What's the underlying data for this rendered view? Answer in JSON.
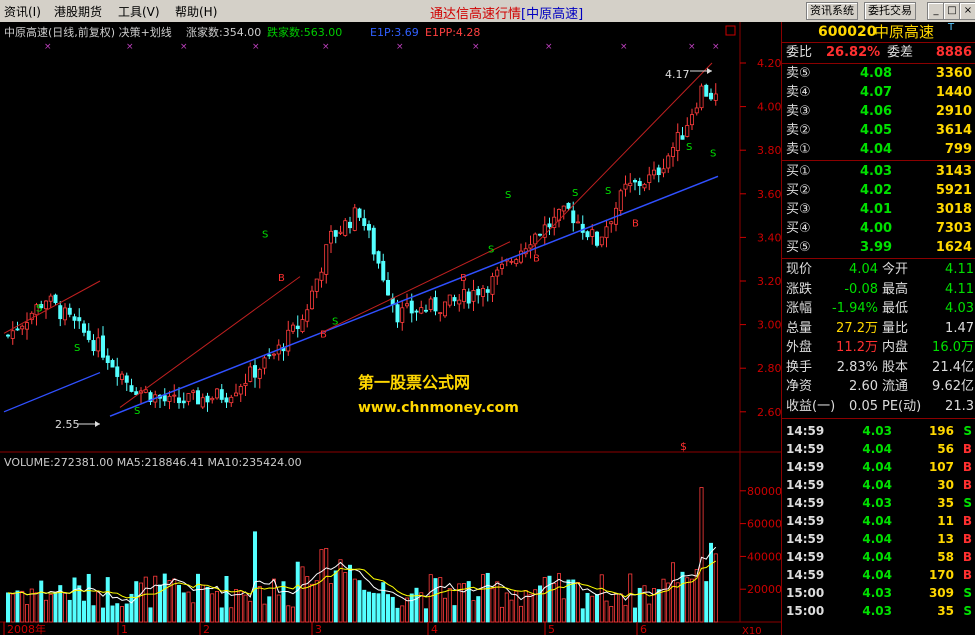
{
  "menu": [
    "资讯(I)",
    "港股期货",
    "工具(V)",
    "帮助(H)"
  ],
  "app_title": "通达信高速行情",
  "app_stock": "[中原高速]",
  "toolbar_buttons": [
    "资讯系统",
    "委托交易"
  ],
  "window_buttons": [
    "_",
    "□",
    "×"
  ],
  "chart": {
    "header": "中原高速(日线,前复权) 决策+划线",
    "up_count": "涨家数:354.00",
    "down_count": "跌家数:563.00",
    "e1p": "E1P:3.69",
    "e1pp": "E1PP:4.28",
    "ylabels": [
      "4.20",
      "4.00",
      "3.80",
      "3.60",
      "3.40",
      "3.20",
      "3.00",
      "2.80",
      "2.60"
    ],
    "low_label": "2.55",
    "high_label": "4.17",
    "watermark_cn": "第一股票公式网",
    "watermark_url": "www.chnmoney.com",
    "volume_header": "VOLUME:272381.00  MA5:218846.41  MA10:235424.00",
    "vol_ylabels": [
      "80000",
      "60000",
      "40000",
      "20000"
    ],
    "vol_unit": "X10",
    "x_labels": [
      "2008年",
      "1",
      "2",
      "3",
      "4",
      "5",
      "6"
    ],
    "signal_b": "B",
    "signal_s": "S",
    "marker": "$",
    "crosses": "×"
  },
  "quote": {
    "code": "600020",
    "name": "中原高速",
    "weibi_label": "委比",
    "weibi_value": "26.82%",
    "weicha_label": "委差",
    "weicha_value": "8886",
    "sells": [
      {
        "label": "卖⑤",
        "price": "4.08",
        "vol": "3360"
      },
      {
        "label": "卖④",
        "price": "4.07",
        "vol": "1440"
      },
      {
        "label": "卖③",
        "price": "4.06",
        "vol": "2910"
      },
      {
        "label": "卖②",
        "price": "4.05",
        "vol": "3614"
      },
      {
        "label": "卖①",
        "price": "4.04",
        "vol": "799"
      }
    ],
    "buys": [
      {
        "label": "买①",
        "price": "4.03",
        "vol": "3143"
      },
      {
        "label": "买②",
        "price": "4.02",
        "vol": "5921"
      },
      {
        "label": "买③",
        "price": "4.01",
        "vol": "3018"
      },
      {
        "label": "买④",
        "price": "4.00",
        "vol": "7303"
      },
      {
        "label": "买⑤",
        "price": "3.99",
        "vol": "1624"
      }
    ],
    "stats": [
      {
        "l1": "现价",
        "v1": "4.04",
        "l2": "今开",
        "v2": "4.11"
      },
      {
        "l1": "涨跌",
        "v1": "-0.08",
        "l2": "最高",
        "v2": "4.11"
      },
      {
        "l1": "涨幅",
        "v1": "-1.94%",
        "l2": "最低",
        "v2": "4.03"
      },
      {
        "l1": "总量",
        "v1": "27.2万",
        "l2": "量比",
        "v2": "1.47"
      },
      {
        "l1": "外盘",
        "v1": "11.2万",
        "l2": "内盘",
        "v2": "16.0万"
      },
      {
        "l1": "换手",
        "v1": "2.83%",
        "l2": "股本",
        "v2": "21.4亿"
      },
      {
        "l1": "净资",
        "v1": "2.60",
        "l2": "流通",
        "v2": "9.62亿"
      },
      {
        "l1": "收益(一)",
        "v1": "0.05",
        "l2": "PE(动)",
        "v2": "21.3"
      }
    ],
    "ticks": [
      {
        "time": "14:59",
        "price": "4.03",
        "vol": "196",
        "side": "S"
      },
      {
        "time": "14:59",
        "price": "4.04",
        "vol": "56",
        "side": "B"
      },
      {
        "time": "14:59",
        "price": "4.04",
        "vol": "107",
        "side": "B"
      },
      {
        "time": "14:59",
        "price": "4.04",
        "vol": "30",
        "side": "B"
      },
      {
        "time": "14:59",
        "price": "4.03",
        "vol": "35",
        "side": "S"
      },
      {
        "time": "14:59",
        "price": "4.04",
        "vol": "11",
        "side": "B"
      },
      {
        "time": "14:59",
        "price": "4.04",
        "vol": "13",
        "side": "B"
      },
      {
        "time": "14:59",
        "price": "4.04",
        "vol": "58",
        "side": "B"
      },
      {
        "time": "14:59",
        "price": "4.04",
        "vol": "170",
        "side": "B"
      },
      {
        "time": "15:00",
        "price": "4.03",
        "vol": "309",
        "side": "S"
      },
      {
        "time": "15:00",
        "price": "4.03",
        "vol": "35",
        "side": "S"
      }
    ]
  }
}
